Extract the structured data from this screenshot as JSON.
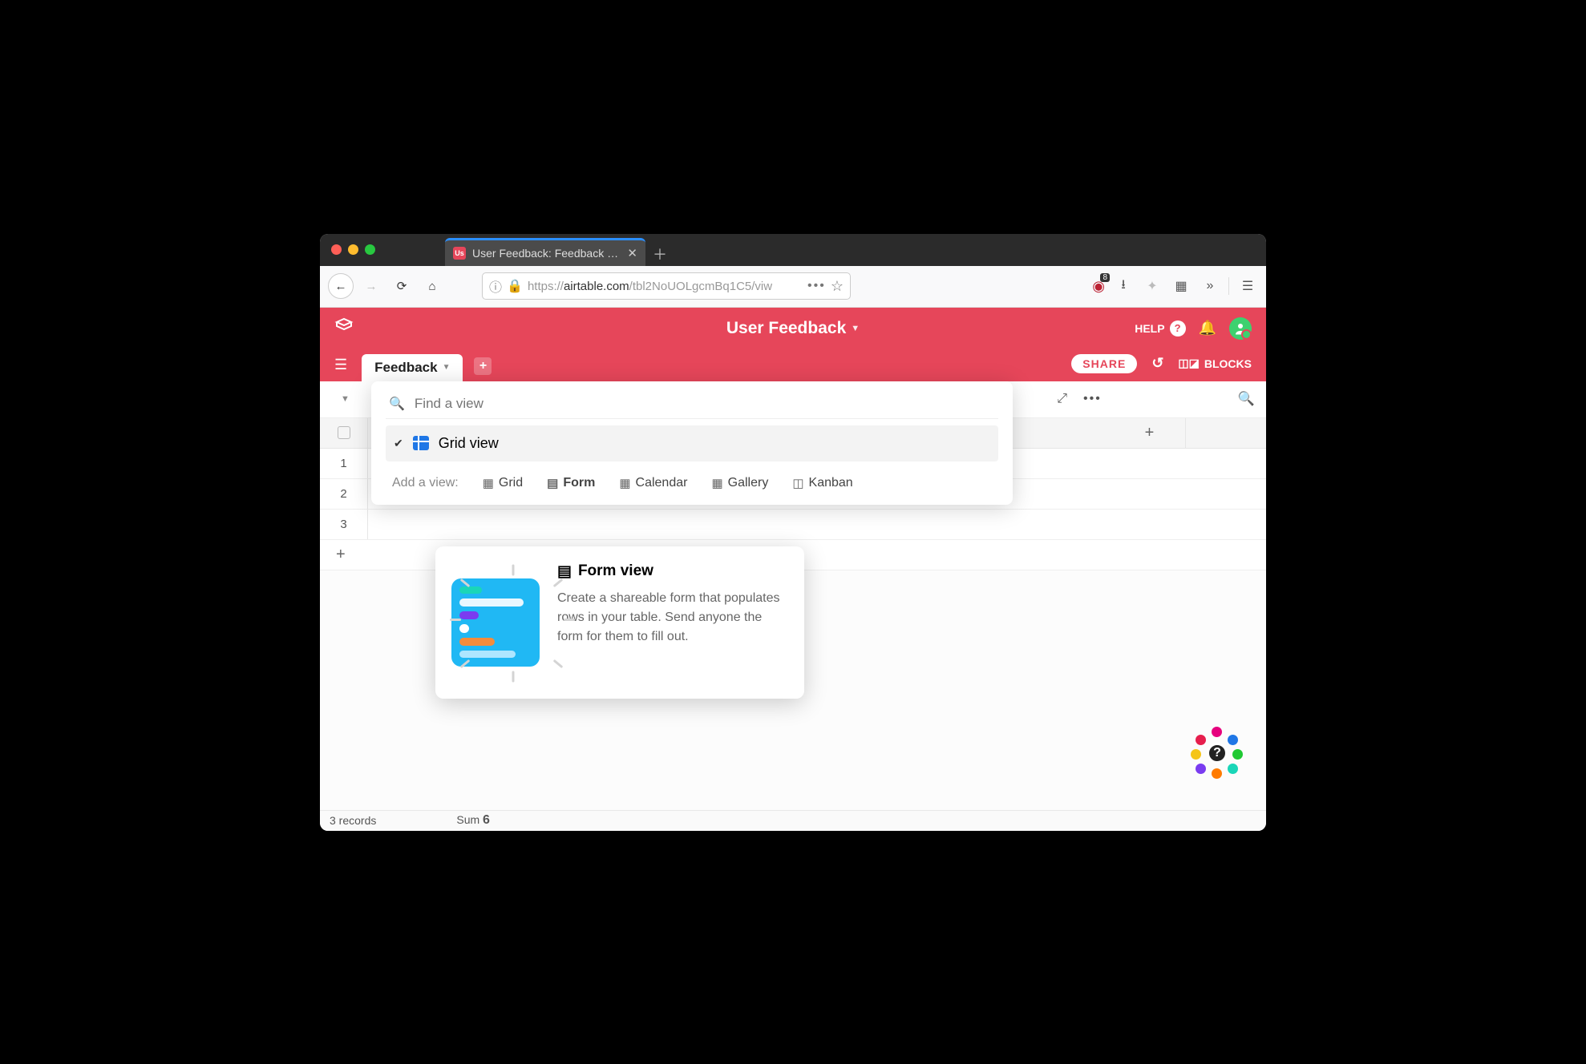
{
  "browser": {
    "tab_title": "User Feedback: Feedback - Airt",
    "url_pre": "https://",
    "url_host": "airtable.com",
    "url_path": "/tbl2NoUOLgcmBq1C5/viw",
    "ext_badge": "8"
  },
  "app": {
    "title": "User Feedback",
    "help_label": "HELP",
    "share_label": "SHARE",
    "blocks_label": "BLOCKS",
    "table_tab": "Feedback"
  },
  "view_popup": {
    "search_placeholder": "Find a view",
    "current_view": "Grid view",
    "add_label": "Add a view:",
    "options": {
      "grid": "Grid",
      "form": "Form",
      "calendar": "Calendar",
      "gallery": "Gallery",
      "kanban": "Kanban"
    }
  },
  "tooltip": {
    "title": "Form view",
    "body": "Create a shareable form that populates rows in your table. Send anyone the form for them to fill out."
  },
  "grid": {
    "rows": [
      "1",
      "2",
      "3"
    ]
  },
  "status": {
    "records": "3 records",
    "sum_label": "Sum",
    "sum_value": "6"
  }
}
